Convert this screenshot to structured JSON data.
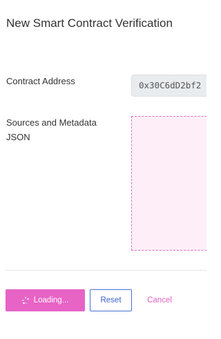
{
  "page": {
    "title": "New Smart Contract Verification"
  },
  "form": {
    "contract_address_label": "Contract Address",
    "contract_address_value": "0x30C6dD2bf2",
    "sources_label": "Sources and Metadata JSON"
  },
  "actions": {
    "loading_label": "Loading...",
    "reset_label": "Reset",
    "cancel_label": "Cancel"
  },
  "colors": {
    "accent": "#e763c6",
    "dropzone_bg": "#fdeef7",
    "reset_border": "#4a6fd6"
  }
}
